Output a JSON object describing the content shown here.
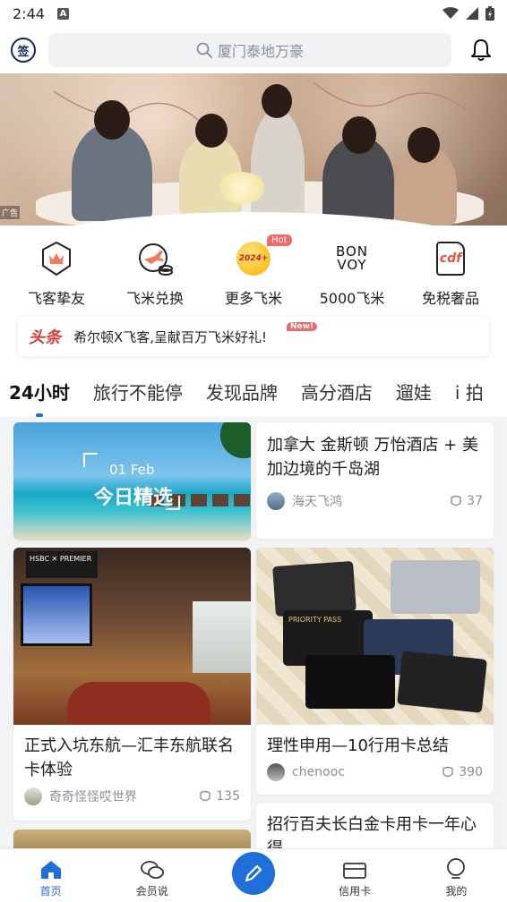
{
  "status_bar": {
    "time": "2:44",
    "notification": "A"
  },
  "header": {
    "logo_char": "签",
    "search_placeholder": "厦门泰地万豪"
  },
  "banner": {
    "ad_label": "广告"
  },
  "shortcuts": [
    {
      "label": "飞客挚友",
      "icon": "crown-badge-icon"
    },
    {
      "label": "飞米兑换",
      "icon": "plane-coin-icon"
    },
    {
      "label": "更多飞米",
      "icon": "2024-coin-icon",
      "badge": "Hot",
      "coin_text": "2024+"
    },
    {
      "label": "5000飞米",
      "icon": "bonvoy-logo",
      "logo_line1": "BON",
      "logo_line2": "VOY"
    },
    {
      "label": "免税奢品",
      "icon": "cdf-logo",
      "logo_text": "cdf"
    }
  ],
  "headline": {
    "tag": "头条",
    "text": "希尔顿X飞客,呈献百万飞米好礼!",
    "badge": "New!"
  },
  "tabs": [
    "24小时",
    "旅行不能停",
    "发现品牌",
    "高分酒店",
    "遛娃",
    "i 拍"
  ],
  "feed": {
    "card1": {
      "image_date": "01 Feb",
      "image_title": "今日精选"
    },
    "card2": {
      "title": "加拿大 金斯顿 万怡酒店 + 美加边境的千岛湖",
      "author": "海天飞鸿",
      "likes": "37"
    },
    "card3": {
      "title": "正式入坑东航—汇丰东航联名卡体验",
      "author": "奇奇怪怪哎世界",
      "likes": "135",
      "sign_text": "HSBC ✕ PREMIER"
    },
    "card4": {
      "title": "理性申用—10行用卡总结",
      "author": "chenooc",
      "likes": "390",
      "card_text": "PRIORITY PASS"
    },
    "card5": {
      "title": "招行百夫长白金卡用卡一年心得"
    }
  },
  "bottom_nav": [
    {
      "label": "首页",
      "icon": "home-icon",
      "active": true
    },
    {
      "label": "会员说",
      "icon": "chat-bubbles-icon"
    },
    {
      "label": "",
      "icon": "pen-icon"
    },
    {
      "label": "信用卡",
      "icon": "card-icon"
    },
    {
      "label": "我的",
      "icon": "profile-icon"
    }
  ],
  "colors": {
    "accent": "#1e6fd9",
    "headline_red": "#e43a3a",
    "hot_badge": "#f06a6a"
  }
}
